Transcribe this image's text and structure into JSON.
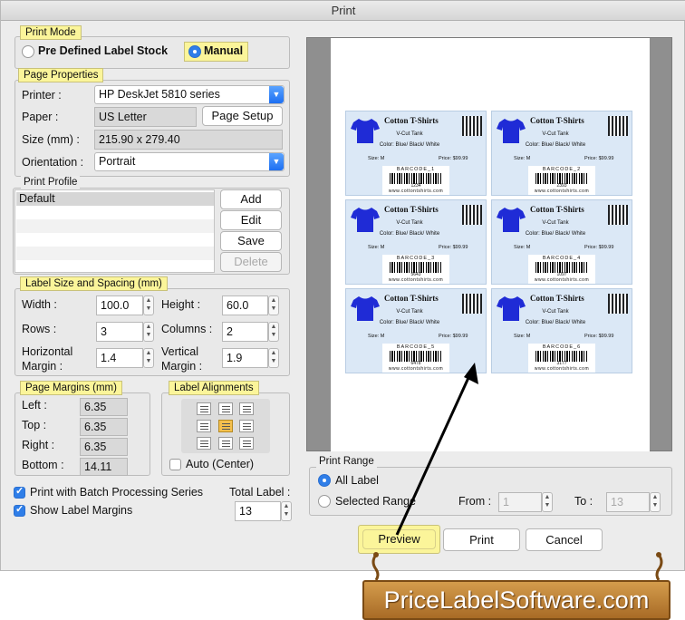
{
  "window": {
    "title": "Print"
  },
  "print_mode": {
    "label": "Print Mode",
    "options": [
      "Pre Defined Label Stock",
      "Manual"
    ],
    "selected": "Manual"
  },
  "page_properties": {
    "label": "Page Properties",
    "printer_label": "Printer :",
    "printer_value": "HP DeskJet 5810 series",
    "paper_label": "Paper :",
    "paper_value": "US Letter",
    "page_setup_button": "Page Setup",
    "size_label": "Size (mm) :",
    "size_value": "215.90 x 279.40",
    "orientation_label": "Orientation :",
    "orientation_value": "Portrait"
  },
  "print_profile": {
    "label": "Print Profile",
    "items": [
      "Default",
      "",
      "",
      "",
      "",
      ""
    ],
    "buttons": {
      "add": "Add",
      "edit": "Edit",
      "save": "Save",
      "delete": "Delete"
    }
  },
  "label_size": {
    "label": "Label Size and Spacing (mm)",
    "width_label": "Width :",
    "width": "100.0",
    "height_label": "Height :",
    "height": "60.0",
    "rows_label": "Rows :",
    "rows": "3",
    "columns_label": "Columns :",
    "columns": "2",
    "hmargin_label_1": "Horizontal",
    "hmargin_label_2": "Margin :",
    "hmargin": "1.4",
    "vmargin_label_1": "Vertical",
    "vmargin_label_2": "Margin :",
    "vmargin": "1.9"
  },
  "page_margins": {
    "label": "Page Margins (mm)",
    "left_label": "Left :",
    "left": "6.35",
    "top_label": "Top :",
    "top": "6.35",
    "right_label": "Right :",
    "right": "6.35",
    "bottom_label": "Bottom :",
    "bottom": "14.11"
  },
  "label_alignments": {
    "label": "Label Alignments",
    "selected_index": 4,
    "auto_center_label": "Auto (Center)",
    "auto_center": false
  },
  "options": {
    "batch_label": "Print with Batch Processing Series",
    "batch": true,
    "margins_label": "Show Label Margins",
    "margins": true,
    "total_label_label": "Total Label :",
    "total_label": "13"
  },
  "print_range": {
    "label": "Print Range",
    "all_label": "All Label",
    "selected_label": "Selected Range",
    "selected": "all",
    "from_label": "From :",
    "from": "1",
    "to_label": "To :",
    "to": "13"
  },
  "buttons": {
    "preview": "Preview",
    "print": "Print",
    "cancel": "Cancel"
  },
  "preview_labels": [
    {
      "title": "Cotton T-Shirts",
      "subtitle": "V-Cut Tank",
      "color": "Color: Blue/ Black/ White",
      "size": "Size: M",
      "price": "Price: $99.99",
      "barcode_title": "BARCODE_1",
      "barcode_num": "1234",
      "web": "www.cottontshirts.com"
    },
    {
      "title": "Cotton T-Shirts",
      "subtitle": "V-Cut Tank",
      "color": "Color: Blue/ Black/ White",
      "size": "Size: M",
      "price": "Price: $99.99",
      "barcode_title": "BARCODE_2",
      "barcode_num": "2393",
      "web": "www.cottontshirts.com"
    },
    {
      "title": "Cotton T-Shirts",
      "subtitle": "V-Cut Tank",
      "color": "Color: Blue/ Black/ White",
      "size": "Size: M",
      "price": "Price: $99.99",
      "barcode_title": "BARCODE_3",
      "barcode_num": "5643",
      "web": "www.cottontshirts.com"
    },
    {
      "title": "Cotton T-Shirts",
      "subtitle": "V-Cut Tank",
      "color": "Color: Blue/ Black/ White",
      "size": "Size: M",
      "price": "Price: $99.99",
      "barcode_title": "BARCODE_4",
      "barcode_num": "1097",
      "web": "www.cottontshirts.com"
    },
    {
      "title": "Cotton T-Shirts",
      "subtitle": "V-Cut Tank",
      "color": "Color: Blue/ Black/ White",
      "size": "Size: M",
      "price": "Price: $99.99",
      "barcode_title": "BARCODE_5",
      "barcode_num": "6478",
      "web": "www.cottontshirts.com"
    },
    {
      "title": "Cotton T-Shirts",
      "subtitle": "V-Cut Tank",
      "color": "Color: Blue/ Black/ White",
      "size": "Size: M",
      "price": "Price: $99.99",
      "barcode_title": "BARCODE_6",
      "barcode_num": "3177",
      "web": "www.cottontshirts.com"
    }
  ],
  "watermark": {
    "text": "PriceLabelSoftware.com"
  },
  "colors": {
    "accent": "#2f7ee8",
    "group_label": "#fbf59a",
    "shirt": "#1f2bd6",
    "label_bg": "#dbe8f6",
    "preview_button": "#fbf59a"
  }
}
